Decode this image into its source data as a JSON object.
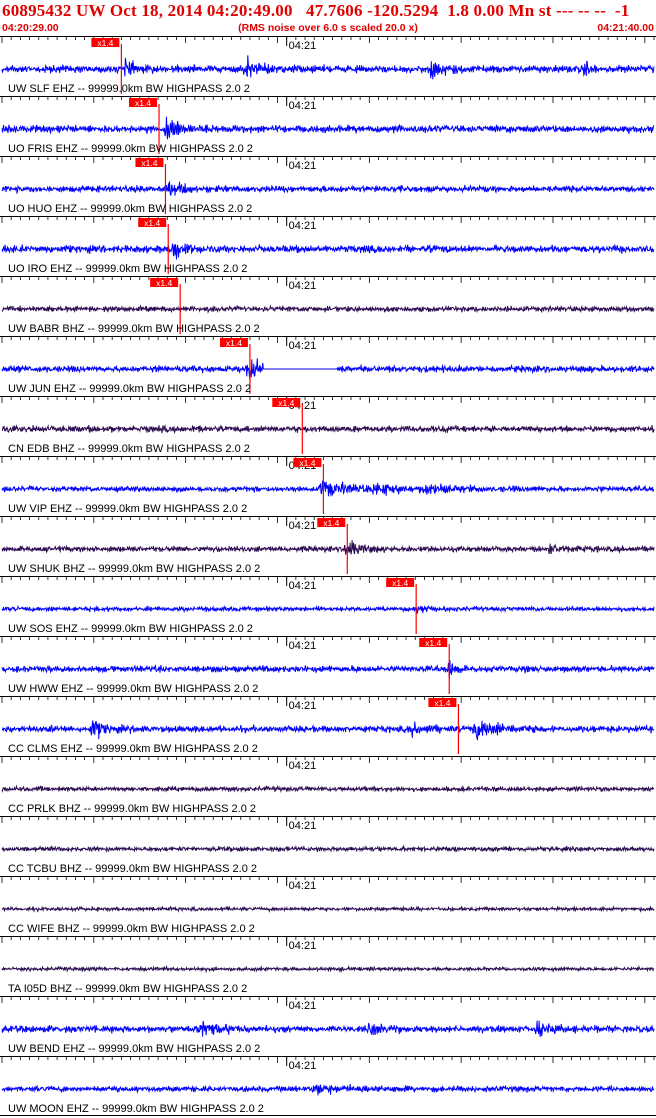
{
  "header": {
    "title": "60895432 UW Oct 18, 2014 04:20:49.00   47.7606 -120.5294  1.8 0.00 Mn st --- -- --  -1",
    "start_time": "04:20:29.00",
    "note": "(RMS noise over 6.0 s scaled 20.0 x)",
    "end_time": "04:21:40.00"
  },
  "colors": {
    "header_text": "#e00000",
    "trace_blue": "#0000ff",
    "trace_dark": "#2a0a50",
    "pick": "#ff0000",
    "tick": "#000000"
  },
  "chart_data": {
    "type": "line",
    "title": "60895432 UW Oct 18, 2014 04:20:49.00   47.7606 -120.5294  1.8 0.00 Mn st --- -- --  -1",
    "x_range_seconds": [
      0,
      71
    ],
    "x_range_labels": [
      "04:20:29.00",
      "04:21:40.00"
    ],
    "minute_marker": {
      "label": "04:21",
      "t": 31
    },
    "pick_label": "x1.4",
    "traces": [
      {
        "label": "UW SLF EHZ -- 99999.0km BW  HIGHPASS  2.0  2",
        "color": "blue",
        "pick_t": 13.0,
        "amp": 8,
        "bursts": [
          [
            13.4,
            0.6,
            3.6
          ],
          [
            26.5,
            1.5,
            2.6
          ],
          [
            46.5,
            1.6,
            2.2
          ],
          [
            63.2,
            0.6,
            3.4
          ]
        ]
      },
      {
        "label": "UO FRIS EHZ -- 99999.0km BW  HIGHPASS  2.0  2",
        "color": "blue",
        "pick_t": 17.1,
        "amp": 8,
        "bursts": [
          [
            17.8,
            1.2,
            4.0
          ]
        ]
      },
      {
        "label": "UO HUO EHZ -- 99999.0km BW  HIGHPASS  2.0  2",
        "color": "blue",
        "pick_t": 17.8,
        "amp": 7,
        "bursts": [
          [
            18.2,
            1.0,
            3.8
          ]
        ]
      },
      {
        "label": "UO IRO EHZ -- 99999.0km BW  HIGHPASS  2.0  2",
        "color": "blue",
        "pick_t": 18.1,
        "amp": 8,
        "bursts": [
          [
            18.5,
            1.0,
            3.6
          ]
        ]
      },
      {
        "label": "UW BABR BHZ -- 99999.0km BW  HIGHPASS  2.0  2",
        "color": "dark",
        "pick_t": 19.4,
        "amp": 6,
        "bursts": []
      },
      {
        "label": "UW JUN EHZ -- 99999.0km BW  HIGHPASS  2.0  2",
        "color": "blue",
        "pick_t": 27.0,
        "amp": 7,
        "bursts": [
          [
            26.6,
            1.2,
            5.0
          ]
        ],
        "flat": [
          28.4,
          36.5
        ]
      },
      {
        "label": "CN EDB BHZ -- 99999.0km BW  HIGHPASS  2.0  2",
        "color": "dark",
        "pick_t": 32.7,
        "amp": 7,
        "bursts": []
      },
      {
        "label": "UW VIP EHZ -- 99999.0km BW  HIGHPASS  2.0  2",
        "color": "blue",
        "pick_t": 35.0,
        "amp": 6,
        "bursts": [
          [
            34.8,
            2.5,
            4.0
          ],
          [
            40.5,
            3.0,
            1.9
          ],
          [
            46.0,
            3.0,
            1.5
          ]
        ]
      },
      {
        "label": "UW SHUK BHZ -- 99999.0km BW  HIGHPASS  2.0  2",
        "color": "dark",
        "pick_t": 37.6,
        "amp": 6,
        "bursts": [
          [
            37.4,
            1.6,
            3.2
          ],
          [
            59.5,
            1.1,
            3.0
          ]
        ]
      },
      {
        "label": "UW SOS EHZ -- 99999.0km BW  HIGHPASS  2.0  2",
        "color": "blue",
        "pick_t": 45.1,
        "amp": 5,
        "bursts": [
          [
            45.2,
            0.9,
            2.4
          ]
        ]
      },
      {
        "label": "UW HWW EHZ -- 99999.0km BW  HIGHPASS  2.0  2",
        "color": "blue",
        "pick_t": 48.7,
        "amp": 7,
        "bursts": [
          [
            48.6,
            0.8,
            3.0
          ]
        ]
      },
      {
        "label": "CC CLMS EHZ -- 99999.0km BW  HIGHPASS  2.0  2",
        "color": "blue",
        "pick_t": 49.7,
        "amp": 7,
        "bursts": [
          [
            9.8,
            1.2,
            3.2
          ],
          [
            44.5,
            1.8,
            1.6
          ],
          [
            51.5,
            2.5,
            3.3
          ]
        ]
      },
      {
        "label": "CC PRLK BHZ -- 99999.0km BW  HIGHPASS  2.0  2",
        "color": "dark",
        "amp": 5,
        "bursts": []
      },
      {
        "label": "CC TCBU BHZ -- 99999.0km BW  HIGHPASS  2.0  2",
        "color": "dark",
        "amp": 5,
        "bursts": []
      },
      {
        "label": "CC WIFE BHZ -- 99999.0km BW  HIGHPASS  2.0  2",
        "color": "dark",
        "amp": 4,
        "bursts": []
      },
      {
        "label": "TA I05D BHZ -- 99999.0km BW  HIGHPASS  2.0  2",
        "color": "dark",
        "amp": 4,
        "bursts": []
      },
      {
        "label": "UW BEND EHZ -- 99999.0km BW  HIGHPASS  2.0  2",
        "color": "blue",
        "amp": 7,
        "bursts": [
          [
            21.5,
            2.5,
            2.4
          ],
          [
            40.0,
            2.0,
            1.6
          ],
          [
            58.0,
            2.5,
            1.8
          ]
        ]
      },
      {
        "label": "UW MOON EHZ -- 99999.0km BW  HIGHPASS  2.0  2",
        "color": "blue",
        "amp": 6,
        "bursts": [
          [
            34.0,
            4.0,
            1.4
          ]
        ]
      }
    ]
  }
}
